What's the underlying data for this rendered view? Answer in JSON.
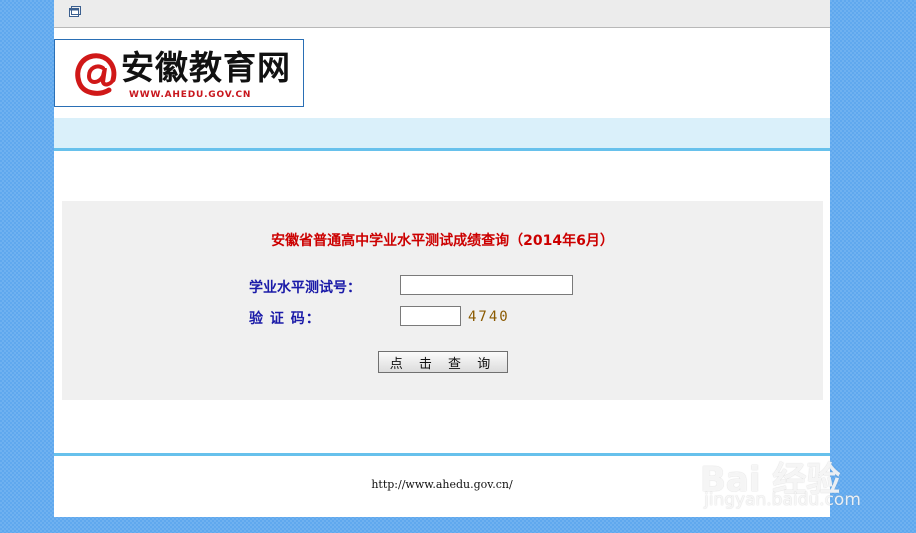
{
  "toolbar": {
    "icon": "window-icon"
  },
  "logo": {
    "brand": "安徽教育网",
    "url": "WWW.AHEDU.GOV.CN",
    "icon": "at-sign-logo"
  },
  "form": {
    "title": "安徽省普通高中学业水平测试成绩查询（2014年6月）",
    "exam_number_label": "学业水平测试号：",
    "exam_number_value": "",
    "captcha_label": "验 证 码：",
    "captcha_value": "",
    "captcha_code": "4740",
    "submit_label": "点 击 查 询"
  },
  "footer": {
    "url": "http://www.ahedu.gov.cn/"
  },
  "watermark": {
    "main": "Bai 经验",
    "sub": "jingyan.baidu.com"
  },
  "colors": {
    "background": "#5fa8ee",
    "accent_line": "#67c1ec",
    "header_band": "#daf0fa",
    "title_red": "#cc0000",
    "label_blue": "#1a1aa8",
    "captcha": "#8b5a00"
  }
}
